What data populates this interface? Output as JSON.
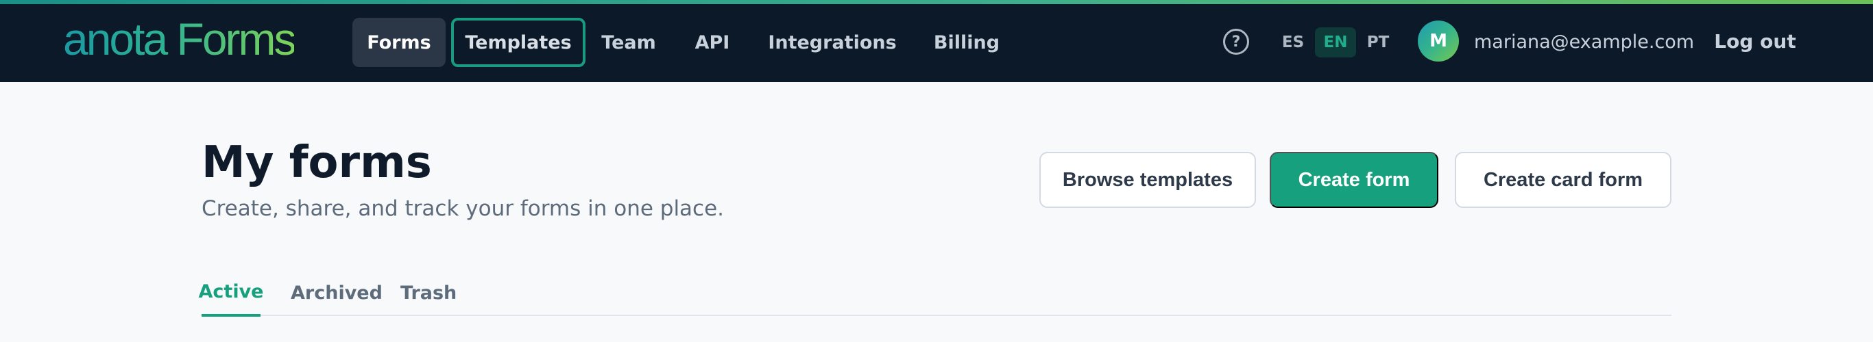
{
  "brand": {
    "logo_text": "anota Forms"
  },
  "nav": {
    "items": [
      {
        "label": "Forms"
      },
      {
        "label": "Templates"
      },
      {
        "label": "Team"
      },
      {
        "label": "API"
      },
      {
        "label": "Integrations"
      },
      {
        "label": "Billing"
      }
    ]
  },
  "header": {
    "help_icon": "question-circle-icon",
    "help_glyph": "?",
    "languages": [
      {
        "code": "ES"
      },
      {
        "code": "EN",
        "active": true
      },
      {
        "code": "PT"
      }
    ],
    "user": {
      "initial": "M",
      "email": "mariana@example.com"
    },
    "logout_label": "Log out"
  },
  "page": {
    "title": "My forms",
    "subtitle": "Create, share, and track your forms in one place.",
    "actions": {
      "browse_label": "Browse templates",
      "create_label": "Create form",
      "card_label": "Create card form"
    },
    "tabs": [
      {
        "label": "Active",
        "active": true
      },
      {
        "label": "Archived"
      },
      {
        "label": "Trash"
      }
    ]
  },
  "colors": {
    "topbar": "#0c1929",
    "accent": "#16a07e",
    "focus_ring": "#1a9b7f",
    "background": "#f7f9fb"
  }
}
